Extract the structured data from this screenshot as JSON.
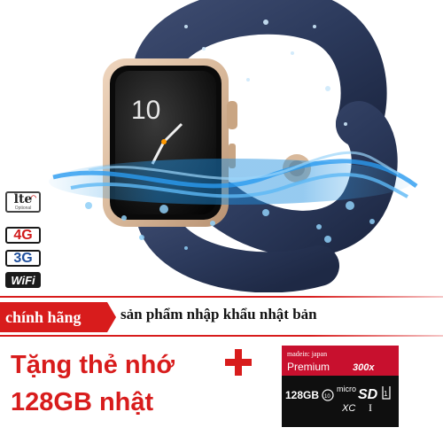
{
  "badges": {
    "lte": "lte",
    "lte_sub": "Optional",
    "four_g": "4G",
    "three_g": "3G",
    "wifi": "WiFi"
  },
  "watch": {
    "time": "10"
  },
  "banner": {
    "tag": "chính hãng",
    "text": "sản phẩm nhập khẩu nhật bản"
  },
  "promo": {
    "line1": "Tặng thẻ nhớ",
    "line2": "128GB nhật"
  },
  "card": {
    "origin": "madein: japan",
    "brand": "Premium",
    "speed": "300x",
    "capacity": "128GB",
    "class_mark": "10",
    "type_line1": "micro",
    "type_line2": "SD",
    "type_line3": "XC",
    "uhs": "1",
    "roman": "I"
  },
  "colors": {
    "brand_red": "#d81c1c",
    "band_navy": "#2c3a5c",
    "case_gold": "#d9b99b"
  }
}
